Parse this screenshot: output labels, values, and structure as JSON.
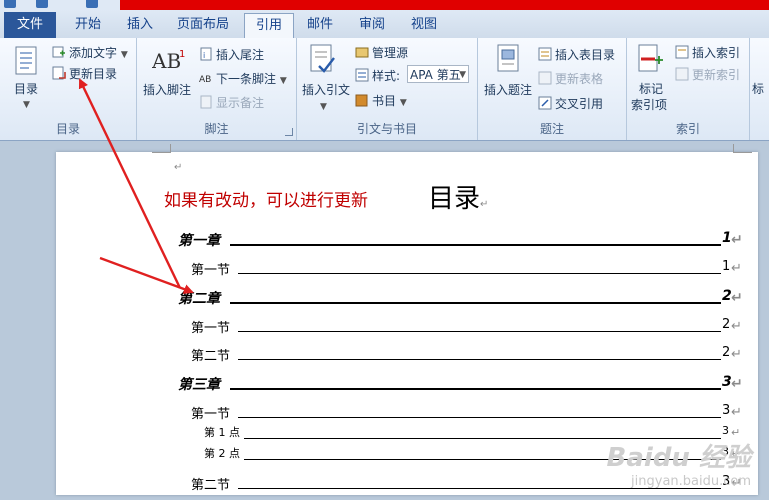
{
  "ribbon_tabs": [
    {
      "label": "文件"
    },
    {
      "label": "开始"
    },
    {
      "label": "插入"
    },
    {
      "label": "页面布局"
    },
    {
      "label": "引用"
    },
    {
      "label": "邮件"
    },
    {
      "label": "审阅"
    },
    {
      "label": "视图"
    }
  ],
  "groups": {
    "toc": {
      "label": "目录",
      "toc_button": "目录",
      "add_text": "添加文字",
      "update_toc": "更新目录"
    },
    "footnotes": {
      "label": "脚注",
      "insert_footnote": "插入脚注",
      "insert_endnote": "插入尾注",
      "next_footnote": "下一条脚注",
      "show_notes": "显示备注"
    },
    "citations": {
      "label": "引文与书目",
      "insert_citation": "插入引文",
      "manage_sources": "管理源",
      "style_label": "样式:",
      "style_value": "APA 第五",
      "bibliography": "书目"
    },
    "captions": {
      "label": "题注",
      "insert_caption": "插入题注",
      "insert_table_of_figures": "插入表目录",
      "update_table": "更新表格",
      "cross_reference": "交叉引用"
    },
    "index": {
      "label": "索引",
      "mark_entry_line1": "标记",
      "mark_entry_line2": "索引项",
      "insert_index": "插入索引",
      "update_index": "更新索引",
      "partial": "标"
    }
  },
  "document": {
    "note": "如果有改动，可以进行更新",
    "toc_title": "目录",
    "entries": [
      {
        "level": 1,
        "label": "第一章",
        "page": "1"
      },
      {
        "level": 2,
        "label": "第一节",
        "page": "1"
      },
      {
        "level": 1,
        "label": "第二章",
        "page": "2"
      },
      {
        "level": 2,
        "label": "第一节",
        "page": "2"
      },
      {
        "level": 2,
        "label": "第二节",
        "page": "2"
      },
      {
        "level": 1,
        "label": "第三章",
        "page": "3"
      },
      {
        "level": 2,
        "label": "第一节",
        "page": "3"
      },
      {
        "level": 3,
        "label": "第 1 点",
        "page": "3"
      },
      {
        "level": 3,
        "label": "第 2 点",
        "page": "3"
      },
      {
        "level": 2,
        "label": "第二节",
        "page": "3"
      }
    ],
    "paragraph_mark": "↵"
  },
  "watermark": {
    "main": "Baidu 经验",
    "sub": "jingyan.baidu.com"
  },
  "colors": {
    "annotation_red": "#c00000",
    "arrow_red": "#e02020",
    "file_tab": "#2b579a"
  }
}
